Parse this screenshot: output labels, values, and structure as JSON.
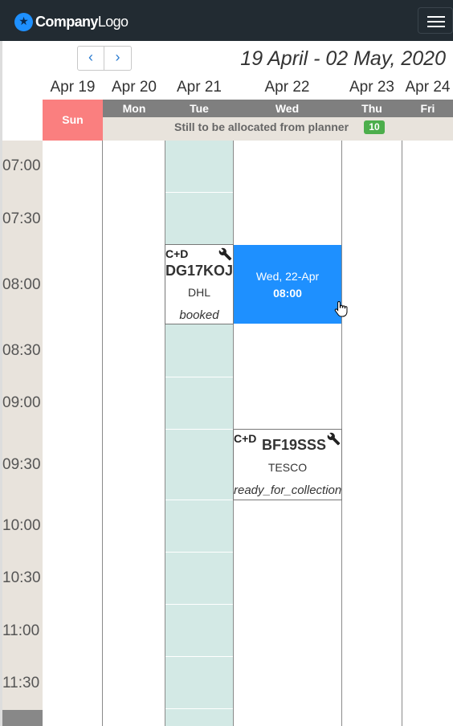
{
  "navbar": {
    "logo": {
      "brand": "Company",
      "suffix": "Logo",
      "icon": "star-icon"
    },
    "menu_icon": "hamburger-icon"
  },
  "toolbar": {
    "prev_icon": "chevron-left-icon",
    "next_icon": "chevron-right-icon",
    "prev_label": "‹",
    "next_label": "›",
    "range_title": "19 April - 02 May, 2020"
  },
  "days": [
    {
      "date": "Apr 19",
      "dow": "Sun"
    },
    {
      "date": "Apr 20",
      "dow": "Mon"
    },
    {
      "date": "Apr 21",
      "dow": "Tue"
    },
    {
      "date": "Apr 22",
      "dow": "Wed"
    },
    {
      "date": "Apr 23",
      "dow": "Thu"
    },
    {
      "date": "Apr 24",
      "dow": "Fri"
    }
  ],
  "allocation": {
    "text": "Still to be allocated from planner",
    "count": "10",
    "badge_color": "#4cae4c"
  },
  "times": [
    "07:00",
    "07:30",
    "08:00",
    "08:30",
    "09:00",
    "09:30",
    "10:00",
    "10:30",
    "11:00",
    "11:30"
  ],
  "bookings": [
    {
      "type": "C+D",
      "registration": "DG17KOJ",
      "carrier": "DHL",
      "status": "booked",
      "icon": "wrench-icon"
    },
    {
      "type": "C+D",
      "registration": "BF19SSS",
      "carrier": "TESCO",
      "status": "ready_for_collection",
      "icon": "wrench-icon"
    }
  ],
  "selection": {
    "date": "Wed, 22-Apr",
    "time": "08:00",
    "color": "#1e90ff"
  },
  "colors": {
    "navbar": "#222b32",
    "sunday": "#fa7f7f",
    "weekday_header": "#7f7f7f",
    "time_column": "#e8e3dc",
    "tuesday_column": "#d3e9e5"
  }
}
